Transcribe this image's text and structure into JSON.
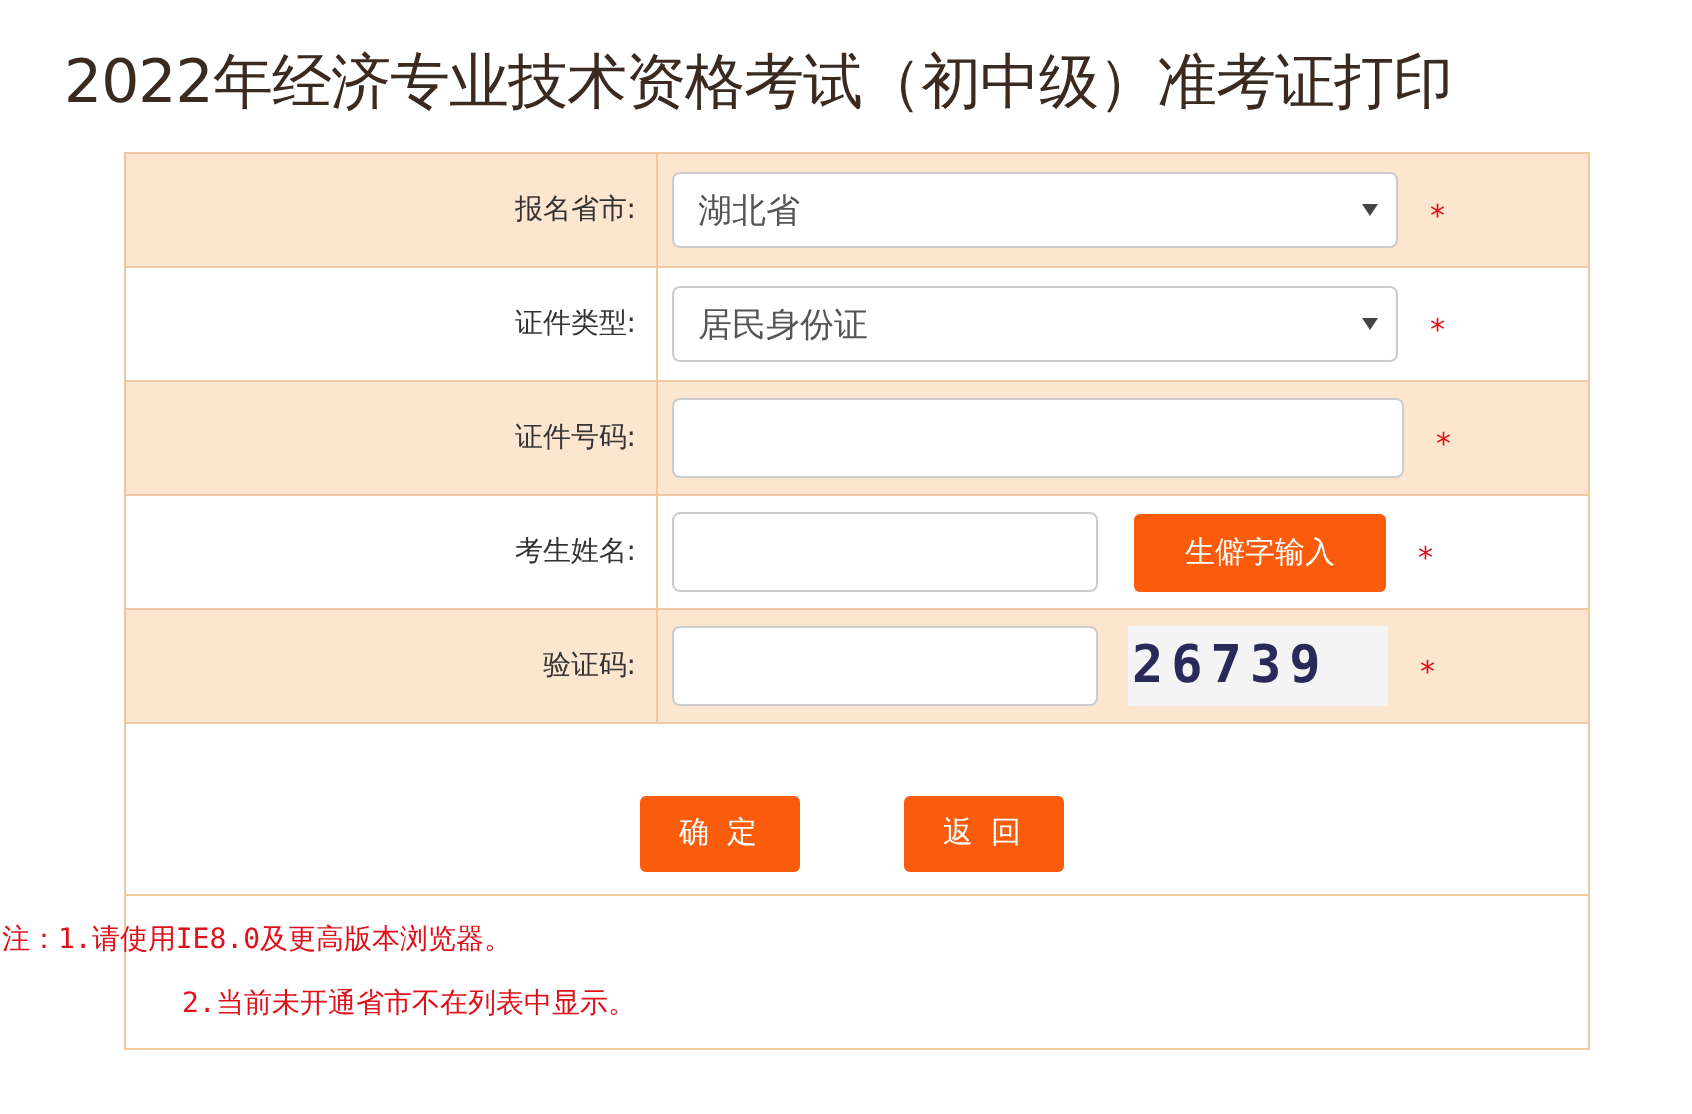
{
  "title": "2022年经济专业技术资格考试（初中级）准考证打印",
  "rows": [
    {
      "kind": "select",
      "label": "报名省市:",
      "value": "湖北省",
      "required_mark": "*"
    },
    {
      "kind": "select",
      "label": "证件类型:",
      "value": "居民身份证",
      "required_mark": "*"
    },
    {
      "kind": "input",
      "label": "证件号码:",
      "required_mark": "*"
    },
    {
      "kind": "input_button",
      "label": "考生姓名:",
      "button": "生僻字输入",
      "required_mark": "*"
    },
    {
      "kind": "captcha",
      "label": "验证码:",
      "captcha": "26739",
      "required_mark": "*"
    }
  ],
  "buttons": [
    "确 定",
    "返 回"
  ],
  "notes": [
    "注：1.请使用IE8.0及更高版本浏览器。",
    "2.当前未开通省市不在列表中显示。"
  ]
}
